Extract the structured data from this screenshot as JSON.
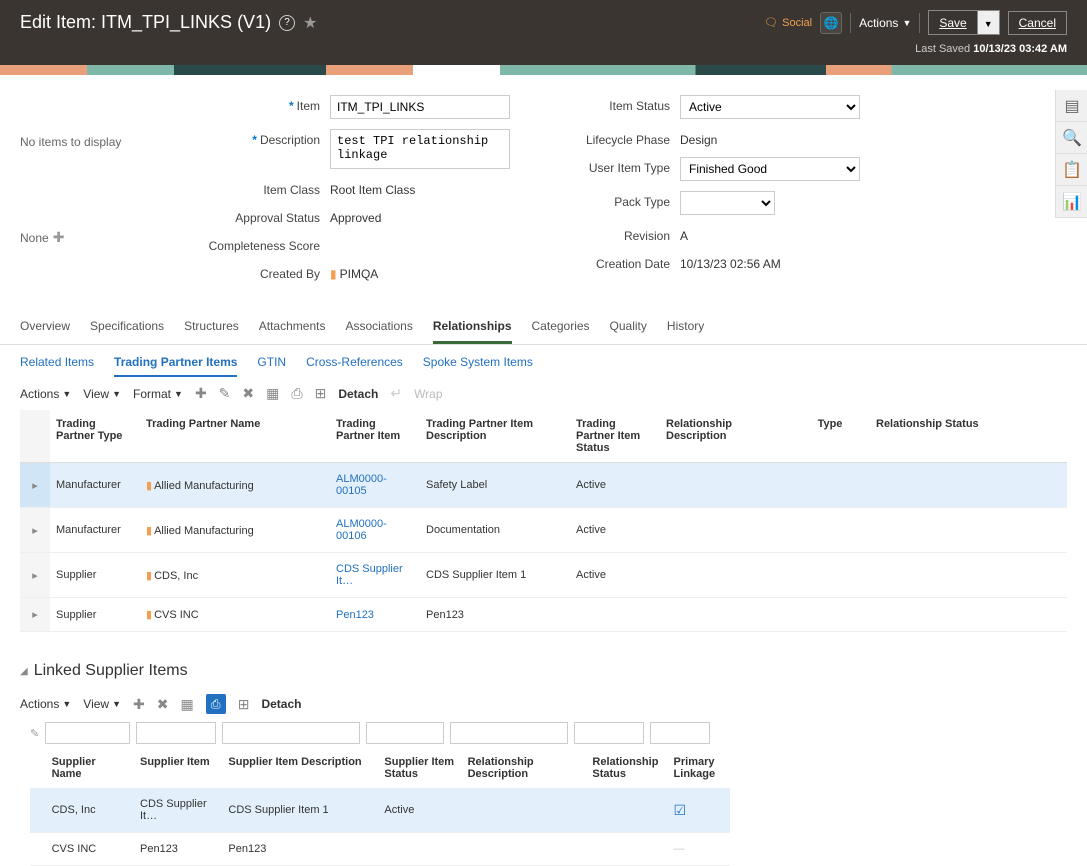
{
  "header": {
    "title": "Edit Item: ITM_TPI_LINKS (V1)",
    "social": "Social",
    "actions": "Actions",
    "save": "Save",
    "cancel": "Cancel",
    "last_saved_label": "Last Saved",
    "last_saved_value": "10/13/23 03:42 AM"
  },
  "left": {
    "no_items": "No items to display",
    "none": "None"
  },
  "form": {
    "item_label": "Item",
    "item_value": "ITM_TPI_LINKS",
    "desc_label": "Description",
    "desc_value": "test TPI relationship linkage",
    "class_label": "Item Class",
    "class_value": "Root Item Class",
    "approval_label": "Approval Status",
    "approval_value": "Approved",
    "completeness_label": "Completeness Score",
    "created_label": "Created By",
    "created_value": "PIMQA",
    "status_label": "Item Status",
    "status_value": "Active",
    "lifecycle_label": "Lifecycle Phase",
    "lifecycle_value": "Design",
    "usertype_label": "User Item Type",
    "usertype_value": "Finished Good",
    "packtype_label": "Pack Type",
    "revision_label": "Revision",
    "revision_value": "A",
    "creation_label": "Creation Date",
    "creation_value": "10/13/23 02:56 AM"
  },
  "tabs": {
    "overview": "Overview",
    "specs": "Specifications",
    "structures": "Structures",
    "attachments": "Attachments",
    "associations": "Associations",
    "relationships": "Relationships",
    "categories": "Categories",
    "quality": "Quality",
    "history": "History"
  },
  "subtabs": {
    "related": "Related Items",
    "tpi": "Trading Partner Items",
    "gtin": "GTIN",
    "crossref": "Cross-References",
    "spoke": "Spoke System Items"
  },
  "toolbar": {
    "actions": "Actions",
    "view": "View",
    "format": "Format",
    "detach": "Detach",
    "wrap": "Wrap"
  },
  "table1": {
    "headers": {
      "type": "Trading Partner Type",
      "name": "Trading Partner Name",
      "item": "Trading Partner Item",
      "desc": "Trading Partner Item Description",
      "status": "Trading Partner Item Status",
      "reldesc": "Relationship Description",
      "reltype": "Type",
      "relstatus": "Relationship Status"
    },
    "rows": [
      {
        "type": "Manufacturer",
        "name": "Allied Manufacturing",
        "item": "ALM0000-00105",
        "desc": "Safety Label",
        "status": "Active"
      },
      {
        "type": "Manufacturer",
        "name": "Allied Manufacturing",
        "item": "ALM0000-00106",
        "desc": "Documentation",
        "status": "Active"
      },
      {
        "type": "Supplier",
        "name": "CDS, Inc",
        "item": "CDS Supplier It…",
        "desc": "CDS Supplier Item 1",
        "status": "Active"
      },
      {
        "type": "Supplier",
        "name": "CVS INC",
        "item": "Pen123",
        "desc": "Pen123",
        "status": ""
      }
    ]
  },
  "section2": {
    "title": "Linked Supplier Items"
  },
  "table2": {
    "headers": {
      "name": "Supplier Name",
      "item": "Supplier Item",
      "desc": "Supplier Item Description",
      "status": "Supplier Item Status",
      "reldesc": "Relationship Description",
      "relstatus": "Relationship Status",
      "primary": "Primary Linkage"
    },
    "rows": [
      {
        "name": "CDS, Inc",
        "item": "CDS Supplier It…",
        "desc": "CDS Supplier Item 1",
        "status": "Active",
        "primary": true
      },
      {
        "name": "CVS INC",
        "item": "Pen123",
        "desc": "Pen123",
        "status": "",
        "primary": false
      }
    ]
  }
}
